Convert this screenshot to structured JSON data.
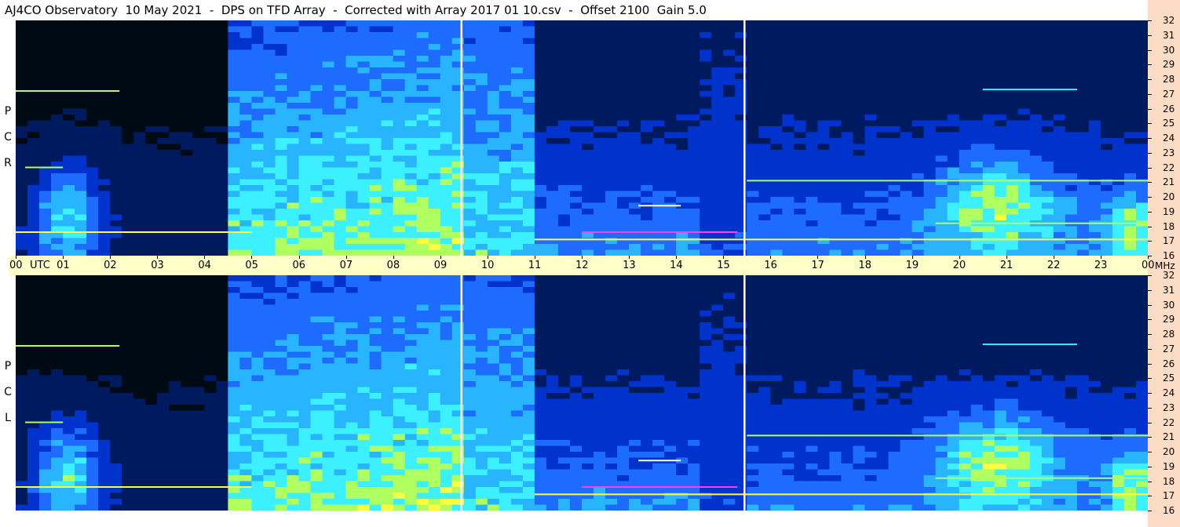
{
  "title": "AJ4CO Observatory  10 May 2021  -  DPS on TFD Array  -  Corrected with Array 2017 01 10.csv  -  Offset 2100  Gain 5.0",
  "chart_data": {
    "type": "heatmap",
    "title": "AJ4CO Observatory  10 May 2021  -  DPS on TFD Array  -  Corrected with Array 2017 01 10.csv  -  Offset 2100  Gain 5.0",
    "panels": [
      {
        "name": "RCP",
        "letters": [
          "R",
          "C",
          "P"
        ]
      },
      {
        "name": "LCP",
        "letters": [
          "L",
          "C",
          "P"
        ]
      }
    ],
    "x_ticks": [
      "00",
      "01",
      "02",
      "03",
      "04",
      "05",
      "06",
      "07",
      "08",
      "09",
      "10",
      "11",
      "12",
      "13",
      "14",
      "15",
      "16",
      "17",
      "18",
      "19",
      "20",
      "21",
      "22",
      "23",
      "00"
    ],
    "x_unit": "UTC",
    "xlim": [
      0,
      24
    ],
    "y_ticks": [
      32,
      31,
      30,
      29,
      28,
      27,
      26,
      25,
      24,
      23,
      22,
      21,
      20,
      19,
      18,
      17,
      16
    ],
    "y_unit": "MHz",
    "ylim": [
      16,
      32
    ],
    "gaps_utc": [
      9.45,
      15.45
    ],
    "colormap": [
      "#000a14",
      "#001a60",
      "#0033cc",
      "#1e6cff",
      "#28b4ff",
      "#3cf0ff",
      "#b0ff60",
      "#ffff40",
      "#ff40ff",
      "#ffffff"
    ]
  }
}
